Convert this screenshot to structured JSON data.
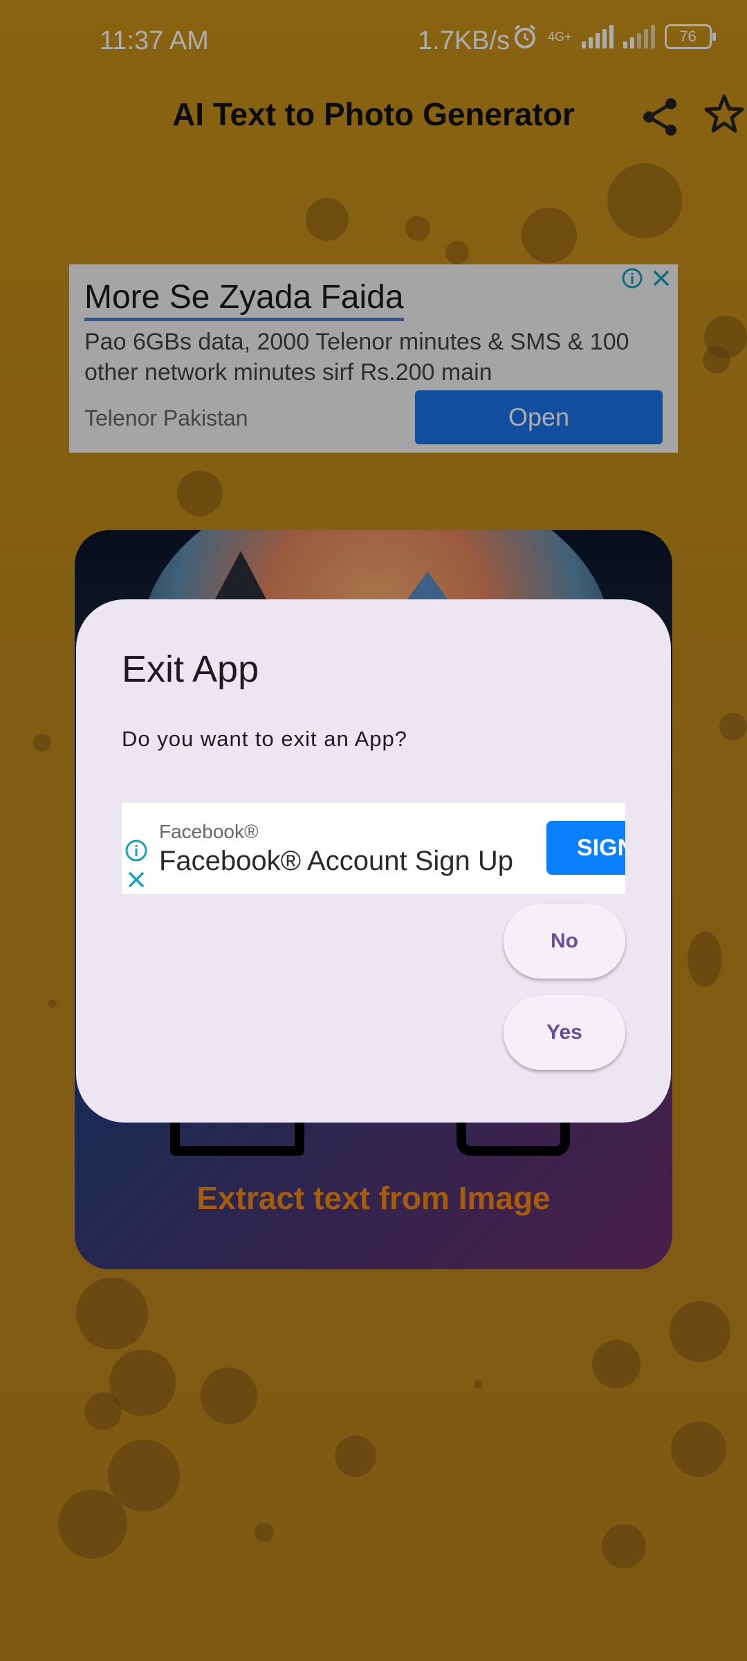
{
  "status_bar": {
    "time": "11:37 AM",
    "network_speed": "1.7KB/s",
    "network_type": "4G+",
    "battery": "76"
  },
  "header": {
    "title": "AI Text to Photo Generator",
    "icons": [
      "share-icon",
      "star-icon"
    ]
  },
  "top_ad": {
    "headline": "More Se Zyada Faida",
    "body": "Pao 6GBs data, 2000 Telenor minutes & SMS & 100 other network minutes sirf Rs.200 main",
    "advertiser": "Telenor Pakistan",
    "cta": "Open",
    "cta_color": "#1a73e8"
  },
  "background_card": {
    "feature_label": "Extract text from Image",
    "label_color": "#f08a12"
  },
  "dialog": {
    "title": "Exit App",
    "message": "Do you want to exit an App?",
    "ad": {
      "advertiser": "Facebook®",
      "headline": "Facebook® Account Sign Up",
      "cta": "SIGN"
    },
    "buttons": {
      "no": "No",
      "yes": "Yes"
    },
    "accent_color": "#6a4d9c",
    "surface_color": "#ece6f3"
  }
}
